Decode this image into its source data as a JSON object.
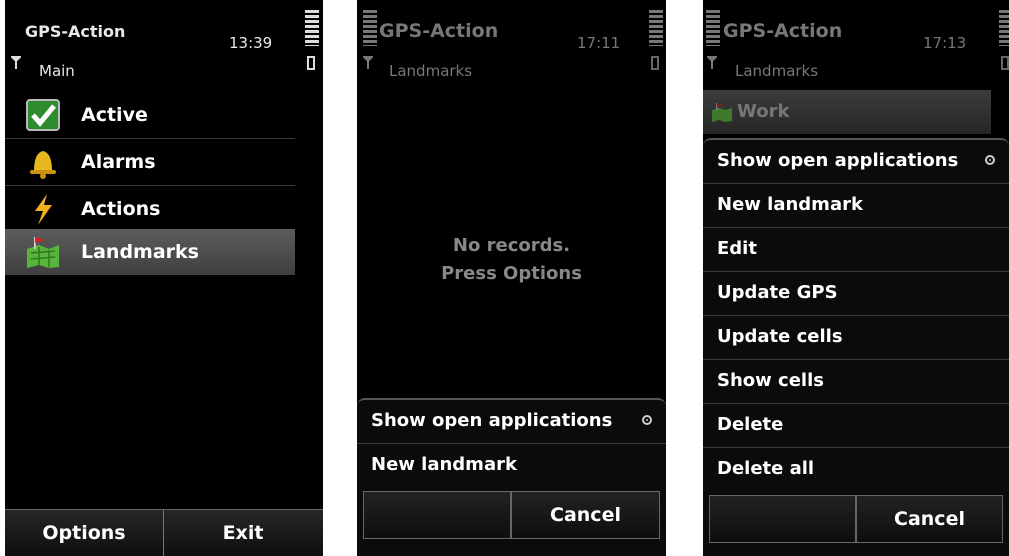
{
  "screen1": {
    "app_title": "GPS-Action",
    "time": "13:39",
    "subtitle": "Main",
    "items": [
      {
        "label": "Active",
        "icon": "checkbox-icon"
      },
      {
        "label": "Alarms",
        "icon": "bell-icon"
      },
      {
        "label": "Actions",
        "icon": "lightning-icon"
      },
      {
        "label": "Landmarks",
        "icon": "map-flag-icon"
      }
    ],
    "selected_item": "Landmarks",
    "softkeys": {
      "left": "Options",
      "right": "Exit"
    }
  },
  "screen2": {
    "app_title": "GPS-Action",
    "time": "17:11",
    "subtitle": "Landmarks",
    "empty_line1": "No records.",
    "empty_line2": "Press Options",
    "popup": [
      {
        "label": "Show open applications",
        "radio": true
      },
      {
        "label": "New landmark"
      }
    ],
    "softkeys": {
      "left": "",
      "right": "Cancel"
    }
  },
  "screen3": {
    "app_title": "GPS-Action",
    "time": "17:13",
    "subtitle": "Landmarks",
    "list_item": "Work",
    "popup": [
      {
        "label": "Show open applications",
        "radio": true
      },
      {
        "label": "New landmark"
      },
      {
        "label": "Edit"
      },
      {
        "label": "Update GPS"
      },
      {
        "label": "Update cells"
      },
      {
        "label": "Show cells"
      },
      {
        "label": "Delete"
      },
      {
        "label": "Delete all"
      }
    ],
    "softkeys": {
      "left": "",
      "right": "Cancel"
    }
  }
}
